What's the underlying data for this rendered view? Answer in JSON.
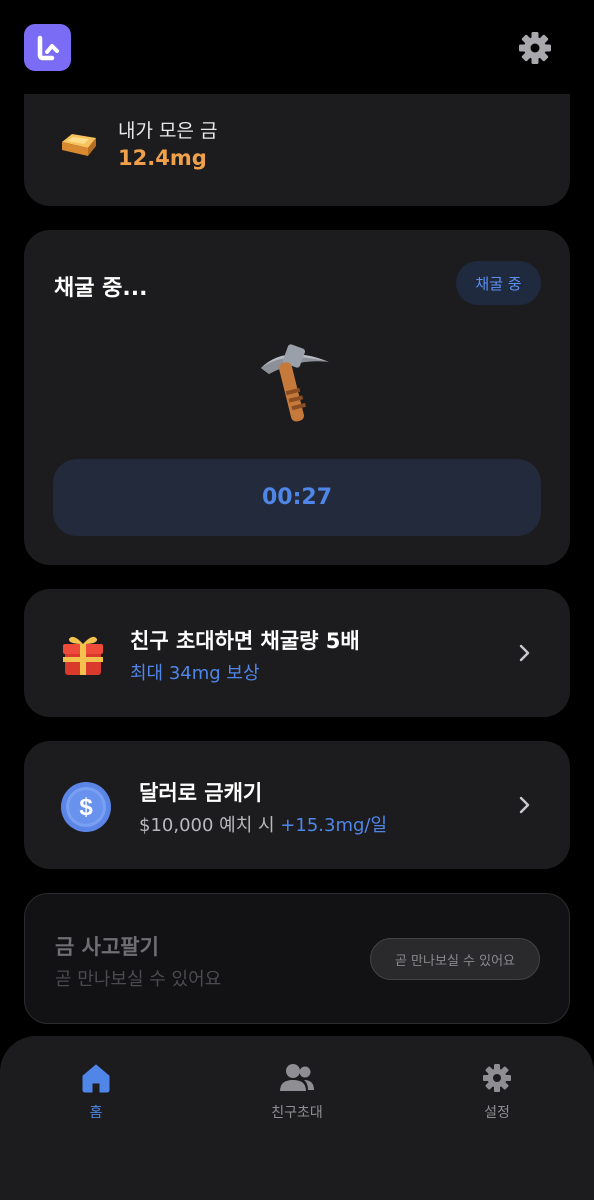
{
  "header": {
    "logo_icon": "app-logo-icon",
    "settings_icon": "gear-icon"
  },
  "gold": {
    "label": "내가 모은 금",
    "amount": "12.4mg",
    "icon": "gold-bar-icon"
  },
  "mining": {
    "title": "채굴 중...",
    "badge": "채굴 중",
    "icon": "pickaxe-icon",
    "timer": "00:27"
  },
  "invite": {
    "icon": "gift-icon",
    "title": "친구 초대하면 채굴량 5배",
    "subtitle": "최대 34mg 보상"
  },
  "dollar": {
    "icon": "dollar-coin-icon",
    "title": "달러로 금캐기",
    "subtitle_prefix": "$10,000 예치 시 ",
    "subtitle_highlight": "+15.3mg/일"
  },
  "trade": {
    "title": "금 사고팔기",
    "subtitle": "곧 만나보실 수 있어요",
    "pill": "곧 만나보실 수 있어요"
  },
  "nav": {
    "items": [
      {
        "label": "홈",
        "icon": "home-icon",
        "active": true
      },
      {
        "label": "친구초대",
        "icon": "users-icon",
        "active": false
      },
      {
        "label": "설정",
        "icon": "gear-icon",
        "active": false
      }
    ]
  },
  "colors": {
    "accent": "#4f86e8",
    "gold": "#f0a04b",
    "logo": "#7b6cf5",
    "card": "#1c1c1e",
    "background": "#000000"
  }
}
